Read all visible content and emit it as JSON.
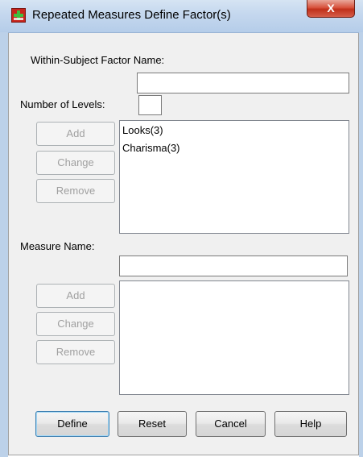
{
  "window": {
    "title": "Repeated Measures Define Factor(s)",
    "close_glyph": "X",
    "app_icon": "spss-dialog-icon"
  },
  "within_subject": {
    "factor_name_label": "Within-Subject Factor Name:",
    "factor_name_value": "",
    "levels_label": "Number of Levels:",
    "levels_value": "",
    "buttons": {
      "add": "Add",
      "change": "Change",
      "remove": "Remove"
    },
    "factors": [
      "Looks(3)",
      "Charisma(3)"
    ]
  },
  "measure": {
    "name_label": "Measure Name:",
    "name_value": "",
    "buttons": {
      "add": "Add",
      "change": "Change",
      "remove": "Remove"
    },
    "measures": []
  },
  "footer": {
    "define": "Define",
    "reset": "Reset",
    "cancel": "Cancel",
    "help": "Help"
  }
}
